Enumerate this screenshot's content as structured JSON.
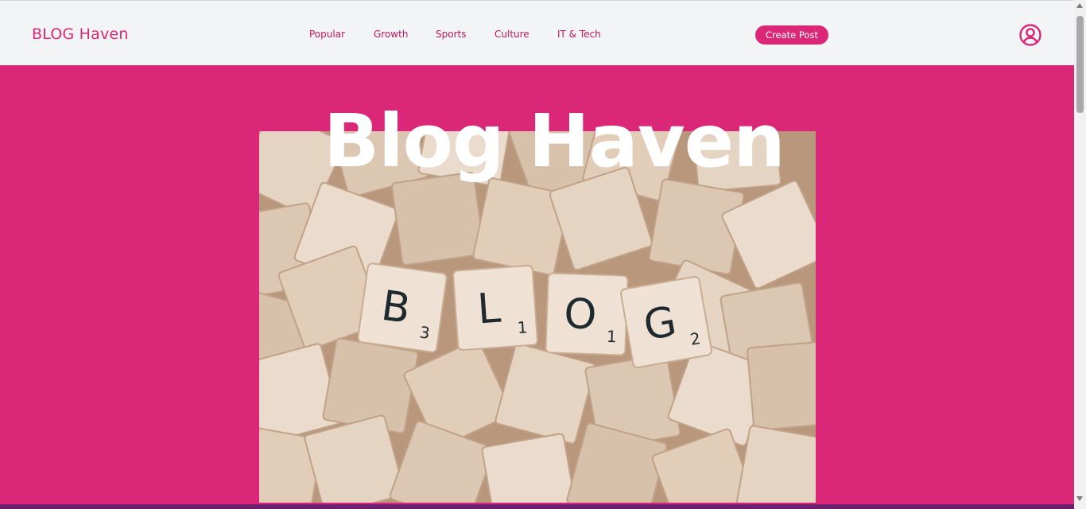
{
  "brand": {
    "name": "BLOG Haven"
  },
  "nav": {
    "links": [
      "Popular",
      "Growth",
      "Sports",
      "Culture",
      "IT & Tech"
    ]
  },
  "actions": {
    "create_post": "Create Post"
  },
  "hero": {
    "title": "Blog Haven",
    "image_tiles": {
      "letters": [
        "B",
        "L",
        "O",
        "G"
      ],
      "subscripts": [
        "3",
        "1",
        "1",
        "2"
      ]
    }
  },
  "colors": {
    "accent": "#db2777",
    "nav_bg": "#f3f4f6",
    "hero_title": "#ffffff"
  },
  "icons": {
    "profile": "user-circle-icon"
  }
}
